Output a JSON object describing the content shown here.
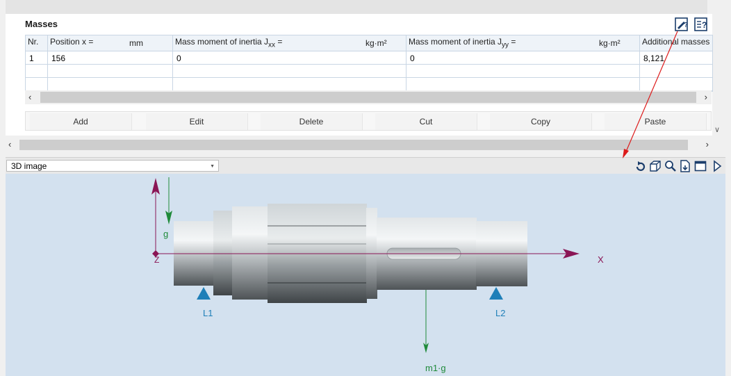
{
  "masses": {
    "title": "Masses",
    "columns": {
      "nr": "Nr.",
      "position": "Position x =",
      "position_unit": "mm",
      "jxx": "Mass moment of inertia J",
      "jxx_sub": "xx",
      "jxx_eq": " =",
      "jxx_unit": "kg·m²",
      "jyy": "Mass moment of inertia J",
      "jyy_sub": "yy",
      "jyy_eq": " =",
      "jyy_unit": "kg·m²",
      "additional": "Additional masses"
    },
    "rows": [
      {
        "nr": "1",
        "position": "156",
        "jxx": "0",
        "jyy": "0",
        "additional": "8,121"
      }
    ],
    "buttons": {
      "add": "Add",
      "edit": "Edit",
      "delete": "Delete",
      "cut": "Cut",
      "copy": "Copy",
      "paste": "Paste"
    }
  },
  "view": {
    "selector": "3D image",
    "toolbar_icons": [
      "rotate-icon",
      "cube-view-icon",
      "zoom-icon",
      "export-icon",
      "window-icon",
      "play-icon"
    ]
  },
  "scene": {
    "axis_x": "X",
    "axis_z": "Z",
    "gravity": "g",
    "bearing_left": "L1",
    "bearing_right": "L2",
    "load": "m1·g",
    "colors": {
      "axis": "#8a1555",
      "gravity": "#1f8a3a",
      "bearing": "#1f7fb8",
      "annotation_arrow": "#dd1b1b"
    }
  }
}
